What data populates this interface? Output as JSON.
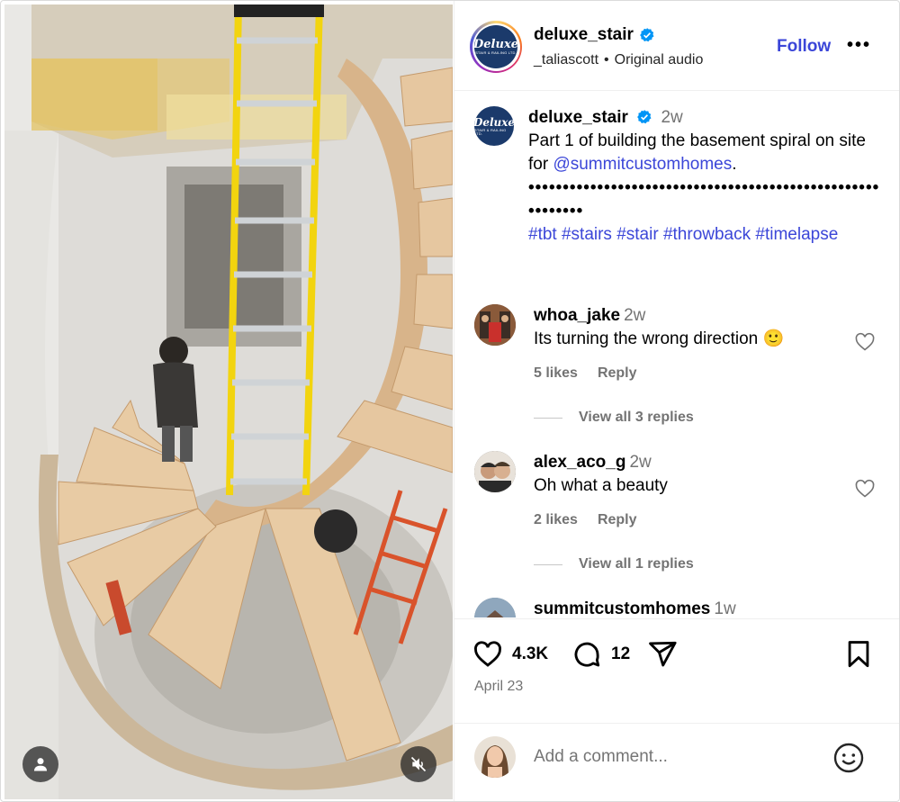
{
  "header": {
    "username": "deluxe_stair",
    "avatar_logo": {
      "brand": "Deluxe",
      "tagline": "STAIR & RAILING LTD."
    },
    "audio_user": "_taliascott",
    "audio_label": "Original audio",
    "follow_label": "Follow",
    "more_label": "•••"
  },
  "caption": {
    "username": "deluxe_stair",
    "time": "2w",
    "text": "Part 1 of building the basement spiral on site for ",
    "mention": "@summitcustomhomes",
    "text_end": ".",
    "dots": "•••••••••••••••••••••••••••••••••••••••••••••••••••••••••••",
    "hashtags": "#tbt #stairs #stair #throwback #timelapse"
  },
  "comments": [
    {
      "username": "whoa_jake",
      "time": "2w",
      "text": "Its turning the wrong direction 🙂",
      "likes": "5 likes",
      "reply": "Reply",
      "view_replies": "View all 3 replies"
    },
    {
      "username": "alex_aco_g",
      "time": "2w",
      "text": "Oh what a beauty",
      "likes": "2 likes",
      "reply": "Reply",
      "view_replies": "View all 1 replies"
    },
    {
      "username": "summitcustomhomes",
      "time": "1w"
    }
  ],
  "actions": {
    "like_count": "4.3K",
    "comment_count": "12",
    "date": "April 23"
  },
  "add_comment": {
    "placeholder": "Add a comment..."
  },
  "colors": {
    "link": "#3b46d8",
    "verified": "#0095f6",
    "muted": "#737373",
    "divider": "#efefef",
    "ladder": "#f2d40f"
  },
  "icons": [
    "verified-badge-icon",
    "heart-icon",
    "comment-icon",
    "share-icon",
    "bookmark-icon",
    "emoji-icon",
    "user-tag-icon",
    "mute-icon"
  ]
}
